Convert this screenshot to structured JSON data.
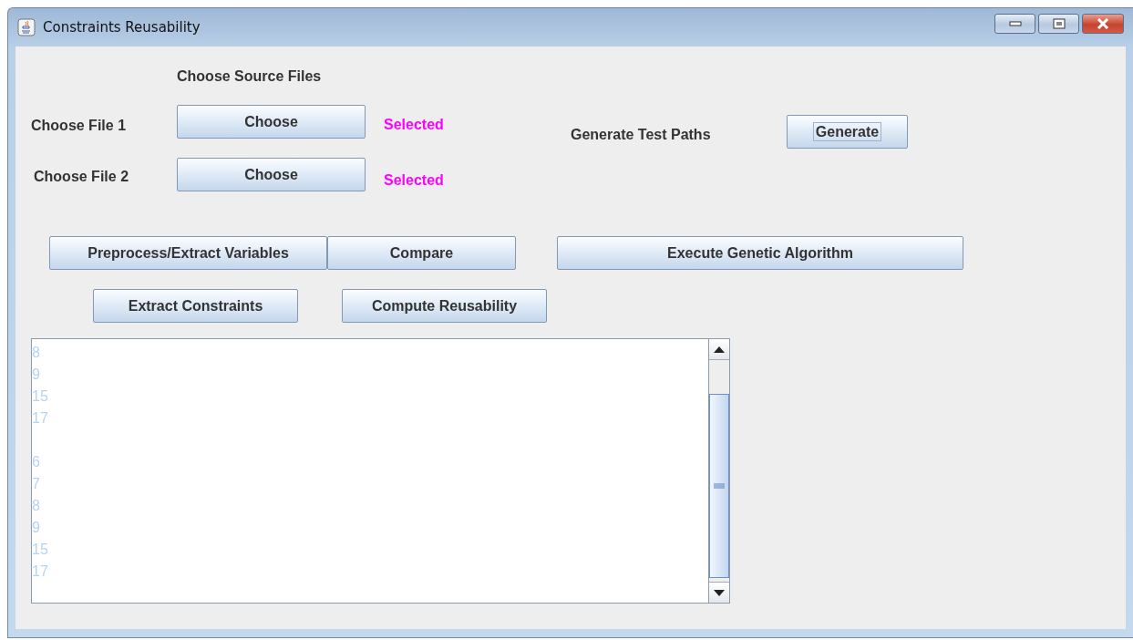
{
  "window": {
    "title": "Constraints Reusability"
  },
  "heading": "Choose Source Files",
  "file_rows": [
    {
      "label": "Choose File 1",
      "button": "Choose",
      "status": "Selected"
    },
    {
      "label": "Choose File 2",
      "button": "Choose",
      "status": "Selected"
    }
  ],
  "generate": {
    "label": "Generate Test Paths",
    "button": "Generate",
    "focused": true
  },
  "action_row_1": [
    {
      "label": "Preprocess/Extract Variables"
    },
    {
      "label": "Compare"
    },
    {
      "label": "Execute Genetic Algorithm"
    }
  ],
  "action_row_2": [
    {
      "label": "Extract Constraints"
    },
    {
      "label": "Compute Reusability"
    }
  ],
  "output": {
    "blocks": [
      [
        "8",
        "9",
        "15",
        "17"
      ],
      [
        "6",
        "7",
        "8",
        "9",
        "15",
        "17"
      ]
    ]
  }
}
